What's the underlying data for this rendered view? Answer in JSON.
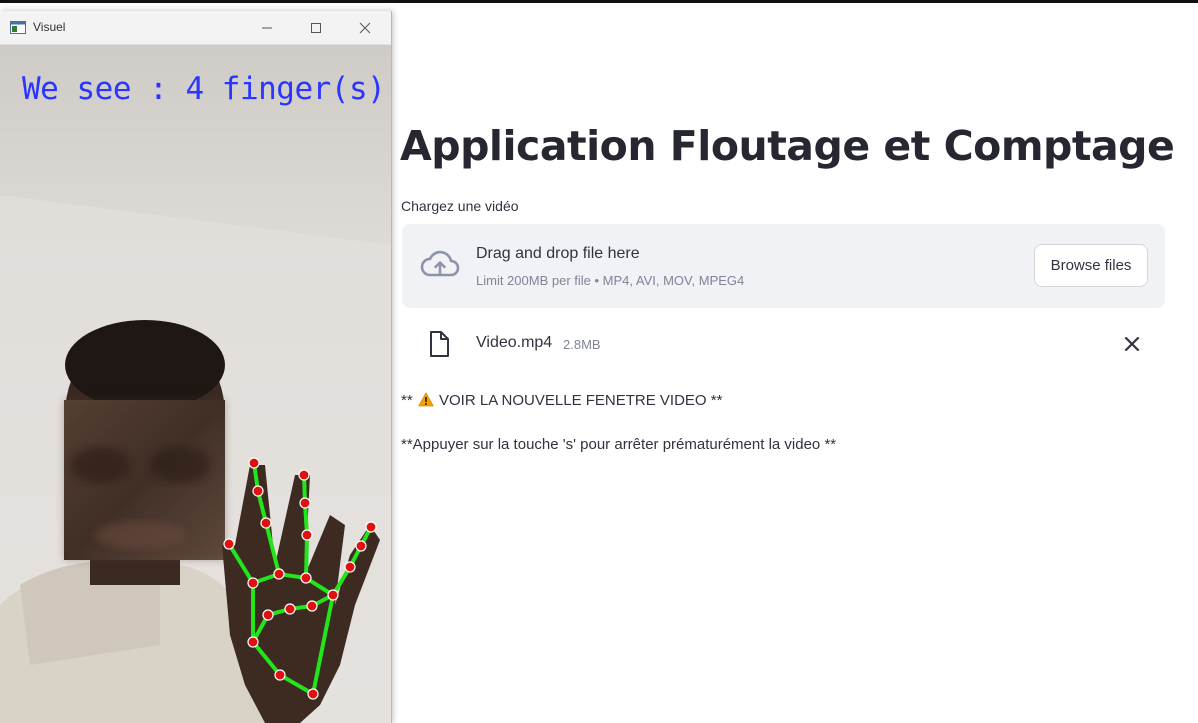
{
  "page": {
    "title": "Application Floutage et Comptage"
  },
  "uploader": {
    "label": "Chargez une vidéo",
    "drag_text": "Drag and drop file here",
    "limit_text": "Limit 200MB per file • MP4, AVI, MOV, MPEG4",
    "browse_label": "Browse files",
    "icon": "cloud-upload-icon"
  },
  "uploaded_file": {
    "name": "Video.mp4",
    "size": "2.8MB",
    "icon": "file-icon",
    "remove_icon": "close-icon"
  },
  "messages": {
    "warning_prefix": "** ",
    "warning_text": " VOIR LA NOUVELLE FENETRE VIDEO **",
    "stop_text": "**Appuyer sur la touche 's' pour arrêter prématurément la video **"
  },
  "cv_window": {
    "title": "Visuel",
    "overlay_text": "We see : 4 finger(s)",
    "controls": {
      "minimize": "—",
      "maximize": "☐",
      "close": "✕"
    }
  },
  "colors": {
    "overlay_text": "#2a36ff",
    "hand_skeleton": "#22e61a",
    "hand_landmark": "#e01010",
    "title_text": "#262730",
    "dropzone_bg": "#f0f2f6"
  }
}
